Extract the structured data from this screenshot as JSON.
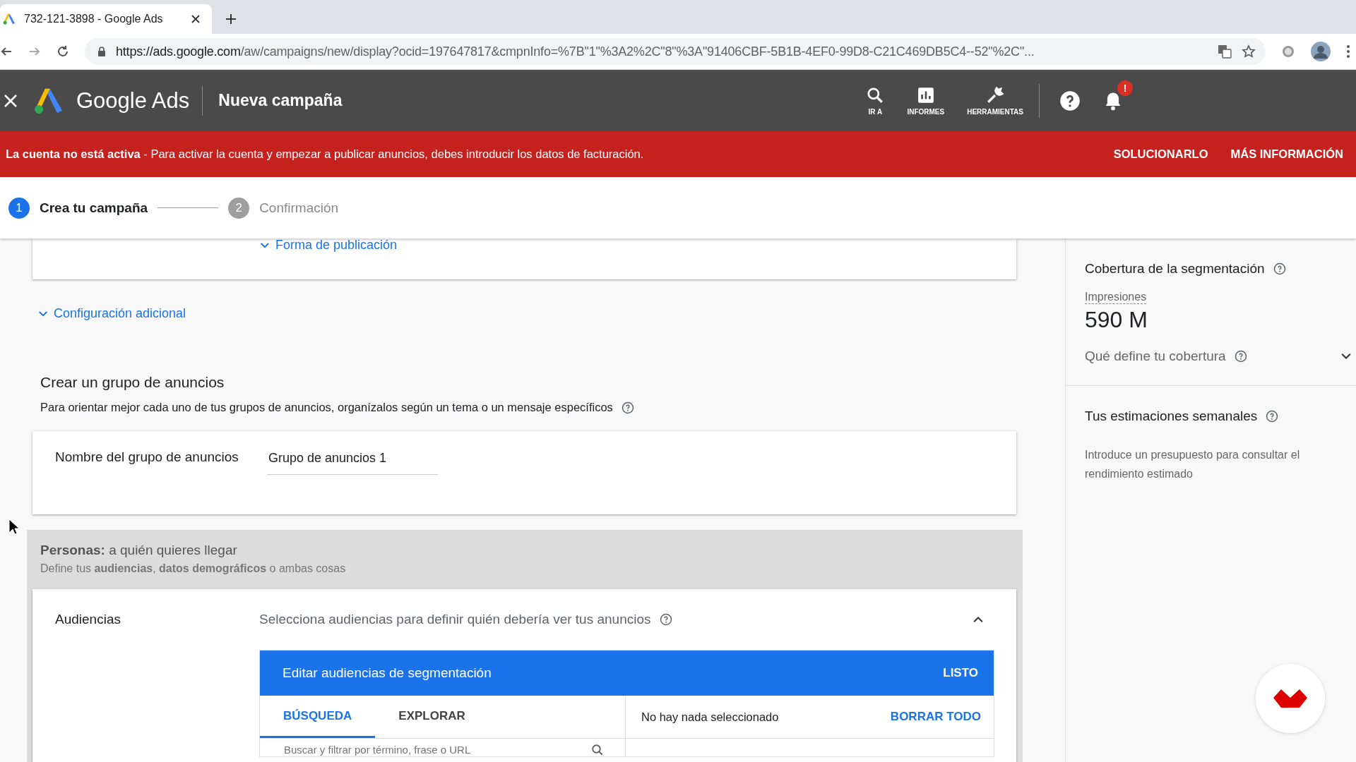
{
  "browser": {
    "tab_title": "732-121-3898 - Google Ads",
    "url_host": "https://ads.google.com",
    "url_path": "/aw/campaigns/new/display?ocid=197647817&cmpnInfo=%7B\"1\"%3A2%2C\"8\"%3A\"91406CBF-5B1B-4EF0-99D8-C21C469DB5C4--52\"%2C\"..."
  },
  "header": {
    "product": "Google Ads",
    "page_title": "Nueva campaña",
    "tools": [
      {
        "label": "IR A",
        "kind": "search"
      },
      {
        "label": "INFORMES",
        "kind": "reports"
      },
      {
        "label": "HERRAMIENTAS",
        "kind": "tools"
      }
    ],
    "notification_badge": "!"
  },
  "alert": {
    "message": "**La cuenta no está activa** - Para activar la cuenta y empezar a publicar anuncios, debes introducir los datos de facturación.",
    "actions": [
      "SOLUCIONARLO",
      "MÁS INFORMACIÓN"
    ]
  },
  "steps": [
    {
      "number": "1",
      "label": "Crea tu campaña",
      "selected": true
    },
    {
      "number": "2",
      "label": "Confirmación",
      "selected": false
    }
  ],
  "sections": {
    "delivery_link": "Forma de publicación",
    "additional_settings": "Configuración adicional",
    "ad_group": {
      "title": "Crear un grupo de anuncios",
      "description": "Para orientar mejor cada uno de tus grupos de anuncios, organízalos según un tema o un mensaje específicos",
      "name_label": "Nombre del grupo de anuncios",
      "name_value": "Grupo de anuncios 1"
    },
    "people": {
      "title": "**Personas:** a quién quieres llegar",
      "description": "Define tus **audiencias**, **datos demográficos** o ambas cosas"
    },
    "audiences": {
      "label": "Audiencias",
      "description": "Selecciona audiencias para definir quién debería ver tus anuncios",
      "expanded": true,
      "editor_title": "Editar audiencias de segmentación",
      "done": "LISTO",
      "tabs": [
        {
          "label": "BÚSQUEDA",
          "selected": true
        },
        {
          "label": "EXPLORAR",
          "selected": false
        }
      ],
      "selection_status": "No hay nada seleccionado",
      "clear_all": "BORRAR TODO",
      "search": {
        "placeholder": "Buscar y filtrar por término, frase o URL"
      }
    }
  },
  "side": {
    "reach_title": "Cobertura de la segmentación",
    "metric_label": "Impresiones",
    "metric_value": "590 M",
    "reach_details": "Qué define tu cobertura",
    "reach_expanded": false,
    "estimates_title": "Tus estimaciones semanales",
    "estimates_text": "Introduce un presupuesto para consultar el rendimiento estimado"
  }
}
